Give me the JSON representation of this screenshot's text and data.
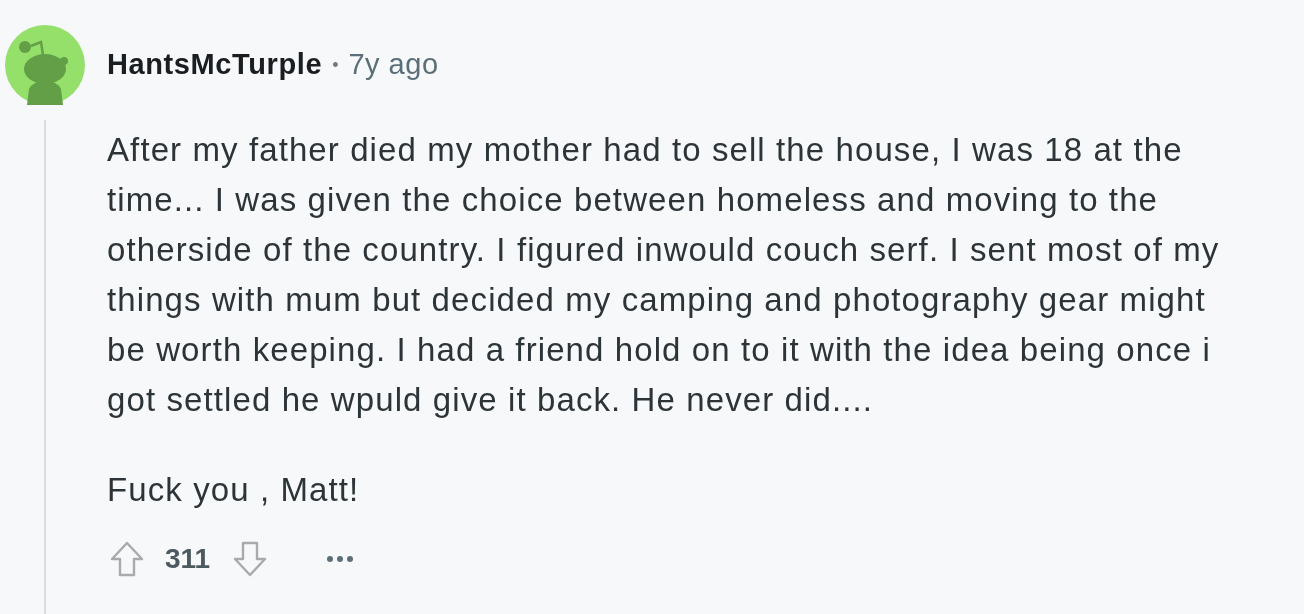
{
  "comment": {
    "author": "HantsMcTurple",
    "separator": "•",
    "age": "7y ago",
    "paragraphs": [
      "After my father died my mother had to sell the house, I was 18 at the time... I was given the choice between homeless and moving to the otherside of the country. I figured inwould couch serf. I sent most of my things with mum but decided my camping and photography gear might be worth keeping. I had a friend hold on to it with the idea being once i got settled he wpuld give it back. He never did....",
      "Fuck you , Matt!"
    ],
    "score": "311"
  }
}
